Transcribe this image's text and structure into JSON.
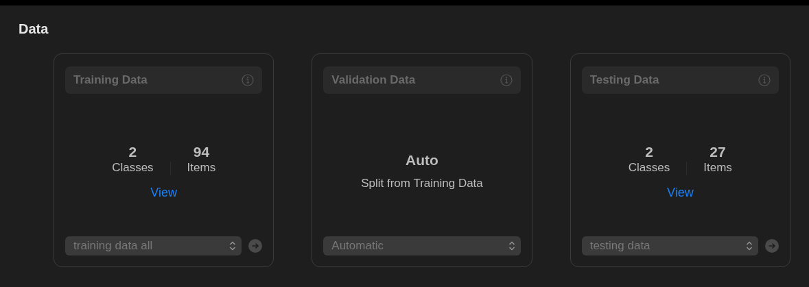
{
  "section": {
    "title": "Data"
  },
  "cards": [
    {
      "kind": "stats",
      "title": "Training Data",
      "stats": [
        {
          "value": "2",
          "label": "Classes"
        },
        {
          "value": "94",
          "label": "Items"
        }
      ],
      "link": "View",
      "dropdown": "training data all",
      "go_button": true
    },
    {
      "kind": "auto",
      "title": "Validation Data",
      "headline": "Auto",
      "caption": "Split from Training Data",
      "dropdown": "Automatic",
      "go_button": false
    },
    {
      "kind": "stats",
      "title": "Testing Data",
      "stats": [
        {
          "value": "2",
          "label": "Classes"
        },
        {
          "value": "27",
          "label": "Items"
        }
      ],
      "link": "View",
      "dropdown": "testing data",
      "go_button": true
    }
  ]
}
